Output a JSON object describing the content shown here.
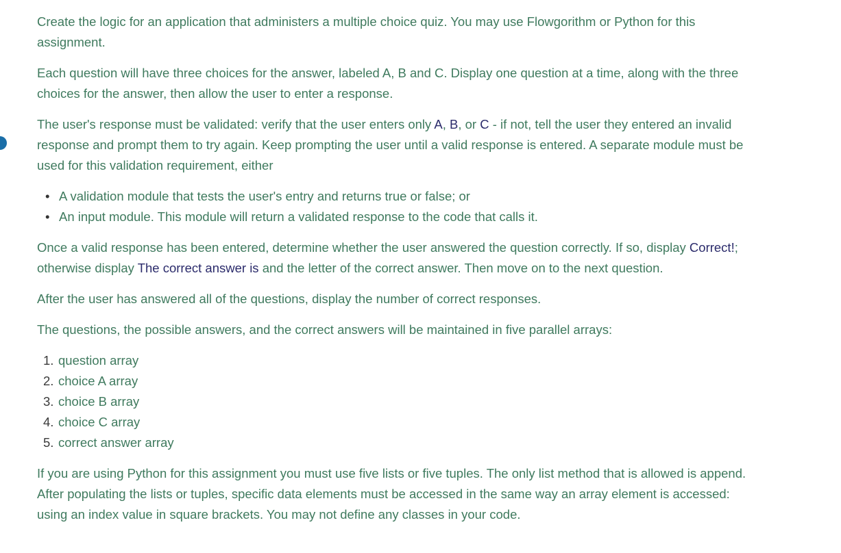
{
  "paragraphs": {
    "p1": "Create the logic for an application that administers a multiple choice quiz. You may use Flowgorithm or Python for this assignment.",
    "p2": "Each question will have three choices for the answer, labeled A, B and C. Display one question at a time, along with the three choices for the answer, then allow the user to enter a response.",
    "p3": {
      "part1": "The user's response must be validated: verify that the user enters only ",
      "a": "A",
      "sep1": ", ",
      "b": "B",
      "sep2": ", or ",
      "c": "C",
      "part2": " - if not, tell the user they entered an invalid response and prompt them to try again. Keep prompting the user until a valid response is entered. A separate module must be used for this validation requirement, either"
    },
    "bullets": [
      "A validation module that tests the user's entry and returns true or false; or",
      "An input module. This module will return a validated response to the code that calls it."
    ],
    "p4": {
      "part1": "Once a valid response has been entered, determine whether the user answered the question correctly. If so, display ",
      "correct": "Correct!",
      "part2": "; otherwise display ",
      "answer_is": "The correct answer is",
      "part3": " and the letter of the correct answer. Then move on to the next question."
    },
    "p5": "After the user has answered all of the questions, display the number of correct responses.",
    "p6": "The questions, the possible answers, and the correct answers will be maintained in five parallel arrays:",
    "arrays": [
      {
        "num": "1.",
        "label": "question array"
      },
      {
        "num": "2.",
        "label": "choice A array"
      },
      {
        "num": "3.",
        "label": "choice B array"
      },
      {
        "num": "4.",
        "label": "choice C array"
      },
      {
        "num": "5.",
        "label": "correct answer array"
      }
    ],
    "p7": "If you are using Python for this assignment you must use five lists or five tuples. The only list method that is allowed is append. After populating the lists or tuples, specific data elements must be accessed in the same way an array element is accessed: using an index value in square brackets. You may not define any classes in your code."
  },
  "bullet_glyph": "•",
  "marker_icon": "info-circle"
}
